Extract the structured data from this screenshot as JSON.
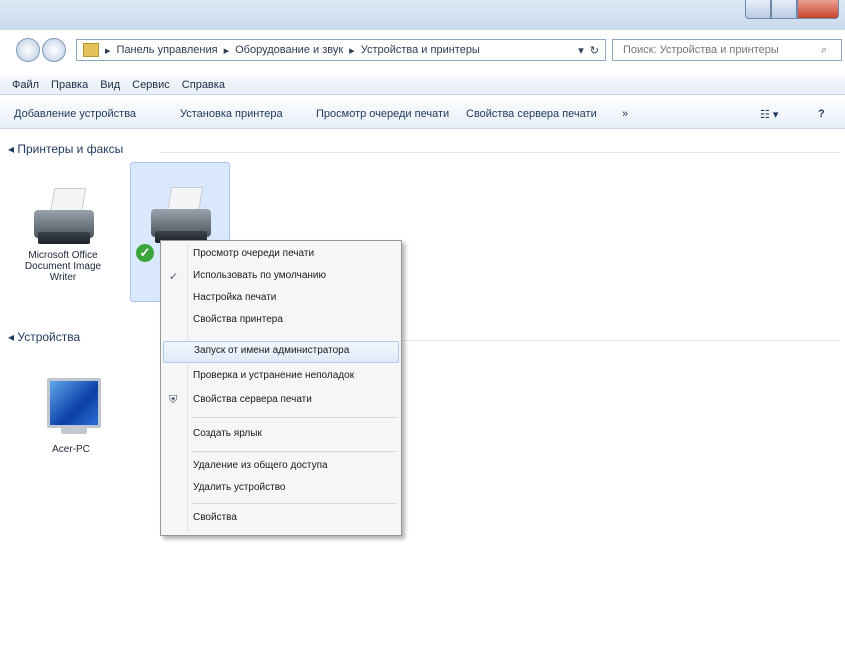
{
  "navigation": {
    "back_icon": "back-arrow-icon",
    "forward_icon": "forward-arrow-icon",
    "breadcrumb": [
      "Панель управления",
      "Оборудование и звук",
      "Устройства и принтеры"
    ],
    "search_placeholder": "Поиск: Устройства и принтеры"
  },
  "menubar": [
    "Файл",
    "Правка",
    "Вид",
    "Сервис",
    "Справка"
  ],
  "toolbar": {
    "add_device": "Добавление устройства",
    "add_printer": "Установка принтера",
    "print_queue": "Просмотр очереди печати",
    "print_server": "Свойства сервера печати",
    "more": "»",
    "view_icon": "view-options-icon",
    "help_icon": "help-icon"
  },
  "groups": {
    "printers": "Принтеры и факсы",
    "devices": "Устройства"
  },
  "devices": {
    "printer1": "Microsoft Office Document Image Writer",
    "computer": "Acer-PC"
  },
  "context_menu": {
    "items": [
      "Просмотр очереди печати",
      "Использовать по умолчанию",
      "Настройка печати",
      "Свойства принтера",
      "Запуск от имени администратора",
      "Проверка и устранение неполадок",
      "Свойства сервера печати",
      "Создать ярлык",
      "Удаление из общего доступа",
      "Удалить устройство",
      "Свойства"
    ],
    "checked_icon": "checkmark-icon",
    "shield_icon": "uac-shield-icon"
  },
  "colors": {
    "accent": "#1e3a5c",
    "selection": "#d9e8fb",
    "default_badge": "#3aa53a"
  }
}
